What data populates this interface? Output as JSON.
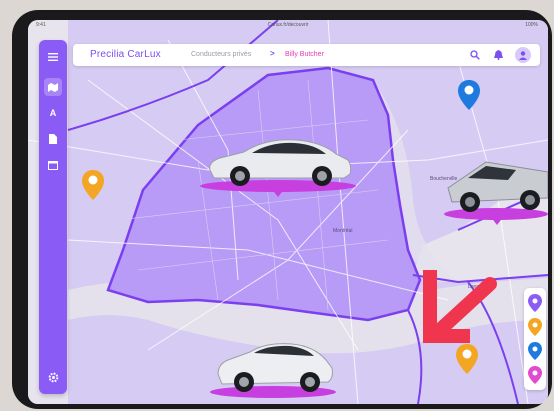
{
  "status_bar": {
    "time": "9:41",
    "url": "Carlux.fr/decouvrir",
    "battery": "100%"
  },
  "header": {
    "brand": "Precilia CarLux",
    "breadcrumb_parent": "Conducteurs privés",
    "breadcrumb_separator": ">",
    "breadcrumb_current": "Billy Butcher"
  },
  "sidebar": {
    "items": [
      {
        "icon": "grid-icon"
      },
      {
        "icon": "map-icon"
      },
      {
        "icon": "text-icon",
        "label": "A"
      },
      {
        "icon": "document-icon"
      },
      {
        "icon": "calendar-icon"
      }
    ],
    "footer_icon": "gear-icon"
  },
  "map": {
    "zone_color": "#b79af7",
    "border_color": "#7b3ff0",
    "place_labels": [
      "Montréal",
      "Boucherville",
      "Longueuil"
    ]
  },
  "vehicles": [
    {
      "name": "Porsche Taycan",
      "color": "silver"
    },
    {
      "name": "Tesla Cybertruck",
      "color": "silver"
    },
    {
      "name": "Mercedes-AMG GT",
      "color": "silver"
    }
  ],
  "filter_pins": [
    {
      "color": "#8a5cf5"
    },
    {
      "color": "#f3a623"
    },
    {
      "color": "#1f7ae0"
    },
    {
      "color": "#e04bd0"
    }
  ],
  "map_pins": [
    {
      "color": "#1f7ae0"
    },
    {
      "color": "#f3a623"
    },
    {
      "color": "#f3a623"
    }
  ],
  "colors": {
    "accent": "#8a5cf5",
    "brand": "#7b4ff0",
    "highlight": "#e63bb7",
    "arrow": "#f0364f"
  }
}
